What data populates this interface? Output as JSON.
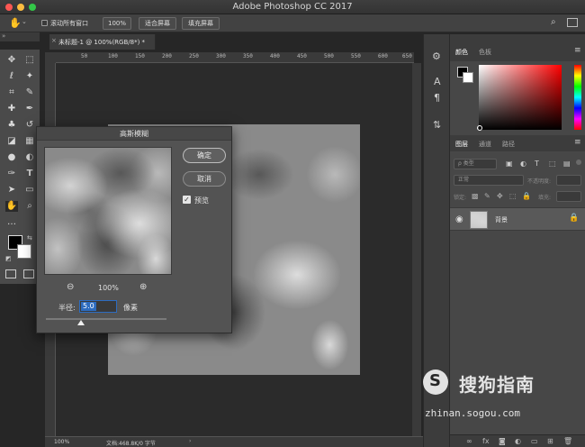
{
  "window": {
    "title": "Adobe Photoshop CC 2017"
  },
  "options_bar": {
    "scroll_all_label": "滚动所有窗口",
    "zoom_100": "100%",
    "fit_screen": "适合屏幕",
    "fill_screen": "填充屏幕"
  },
  "document": {
    "tab_title": "未标题-1 @ 100%(RGB/8*) *",
    "ruler_ticks": [
      "50",
      "100",
      "150",
      "200",
      "250",
      "300",
      "350",
      "400",
      "450",
      "500",
      "550",
      "600",
      "650"
    ]
  },
  "dialog": {
    "title": "高斯模糊",
    "ok_label": "确定",
    "cancel_label": "取消",
    "preview_label": "预览",
    "zoom_level": "100%",
    "radius_label": "半径:",
    "radius_value": "5.0",
    "radius_unit": "像素"
  },
  "panels": {
    "color_tab": "颜色",
    "swatches_tab": "色板",
    "layers_tab": "图层",
    "channels_tab": "通道",
    "paths_tab": "路径",
    "kind_filter": "ρ 类型",
    "blend_mode": "正常",
    "opacity_label": "不透明度:",
    "lock_label": "锁定:",
    "fill_label": "填充:",
    "layer_name": "背景"
  },
  "status": {
    "zoom": "100%",
    "doc_info": "文档:468.8K/0 字节"
  },
  "watermark": {
    "name": "搜狗指南",
    "url": "zhinan.sogou.com"
  },
  "colors": {
    "accent": "#2d6cc0",
    "close": "#fc5753",
    "minimize": "#fdbc40",
    "zoom": "#33c748"
  }
}
